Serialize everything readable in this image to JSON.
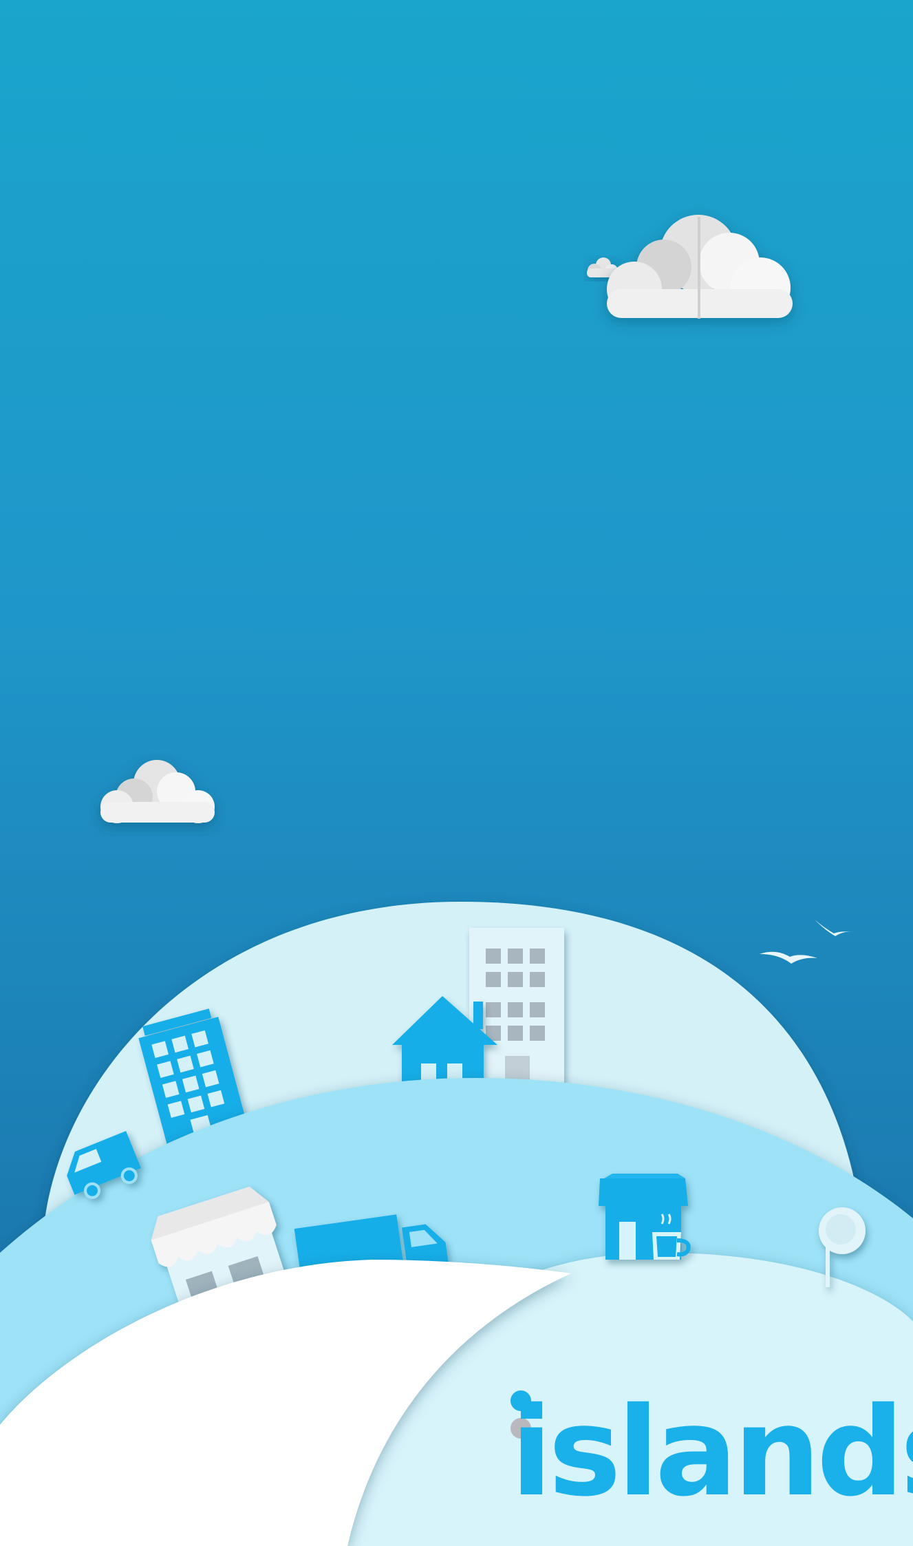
{
  "brand": {
    "name": "islands",
    "accent_color": "#1ab0ea",
    "dot_secondary_color": "#b9b9bd"
  },
  "scene": {
    "sky_colors": [
      "#1aa5cc",
      "#1a74a8"
    ],
    "hill_colors": [
      "#d4f1f8",
      "#9de2f7",
      "#ffffff",
      "#d8f4fb"
    ],
    "icons": [
      "cloud-icon",
      "cloud-icon",
      "office-building-icon",
      "house-icon",
      "hotel-building-icon",
      "van-icon",
      "store-icon",
      "truck-icon",
      "cafe-icon",
      "tree-icon",
      "bird-icon"
    ]
  }
}
